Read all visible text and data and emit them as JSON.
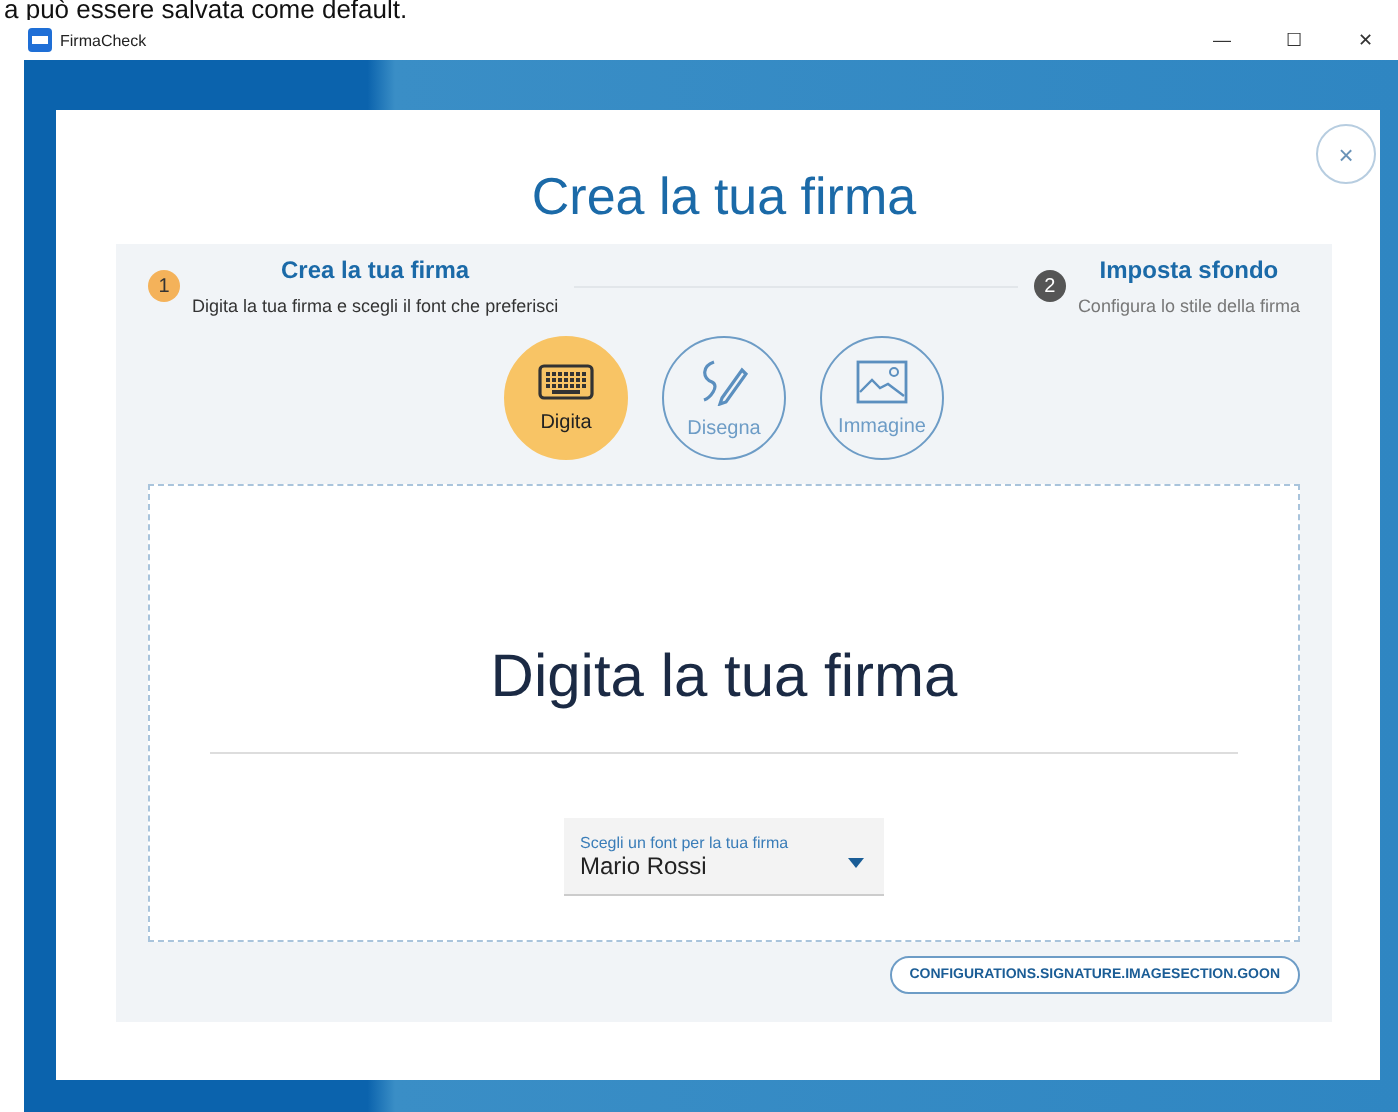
{
  "background_text": "a può essere salvata come default.",
  "window": {
    "title": "FirmaCheck",
    "controls": [
      "—",
      "☐",
      "✕"
    ]
  },
  "dialog": {
    "title": "Crea la tua firma",
    "close": "×"
  },
  "steps": [
    {
      "number": "1",
      "title": "Crea la tua firma",
      "subtitle": "Digita la tua firma e scegli il font che preferisci",
      "selected": true
    },
    {
      "number": "2",
      "title": "Imposta sfondo",
      "subtitle": "Configura lo stile della firma",
      "selected": false
    }
  ],
  "modes": [
    {
      "kind": "keyboard",
      "label": "Digita",
      "selected": true
    },
    {
      "kind": "pen",
      "label": "Disegna",
      "selected": false
    },
    {
      "kind": "image",
      "label": "Immagine",
      "selected": false
    }
  ],
  "signature": {
    "placeholder": "Digita la tua firma"
  },
  "font_select": {
    "label": "Scegli un font per la tua firma",
    "value": "Mario Rossi"
  },
  "next_button": "CONFIGURATIONS.SIGNATURE.IMAGESECTION.GOON"
}
